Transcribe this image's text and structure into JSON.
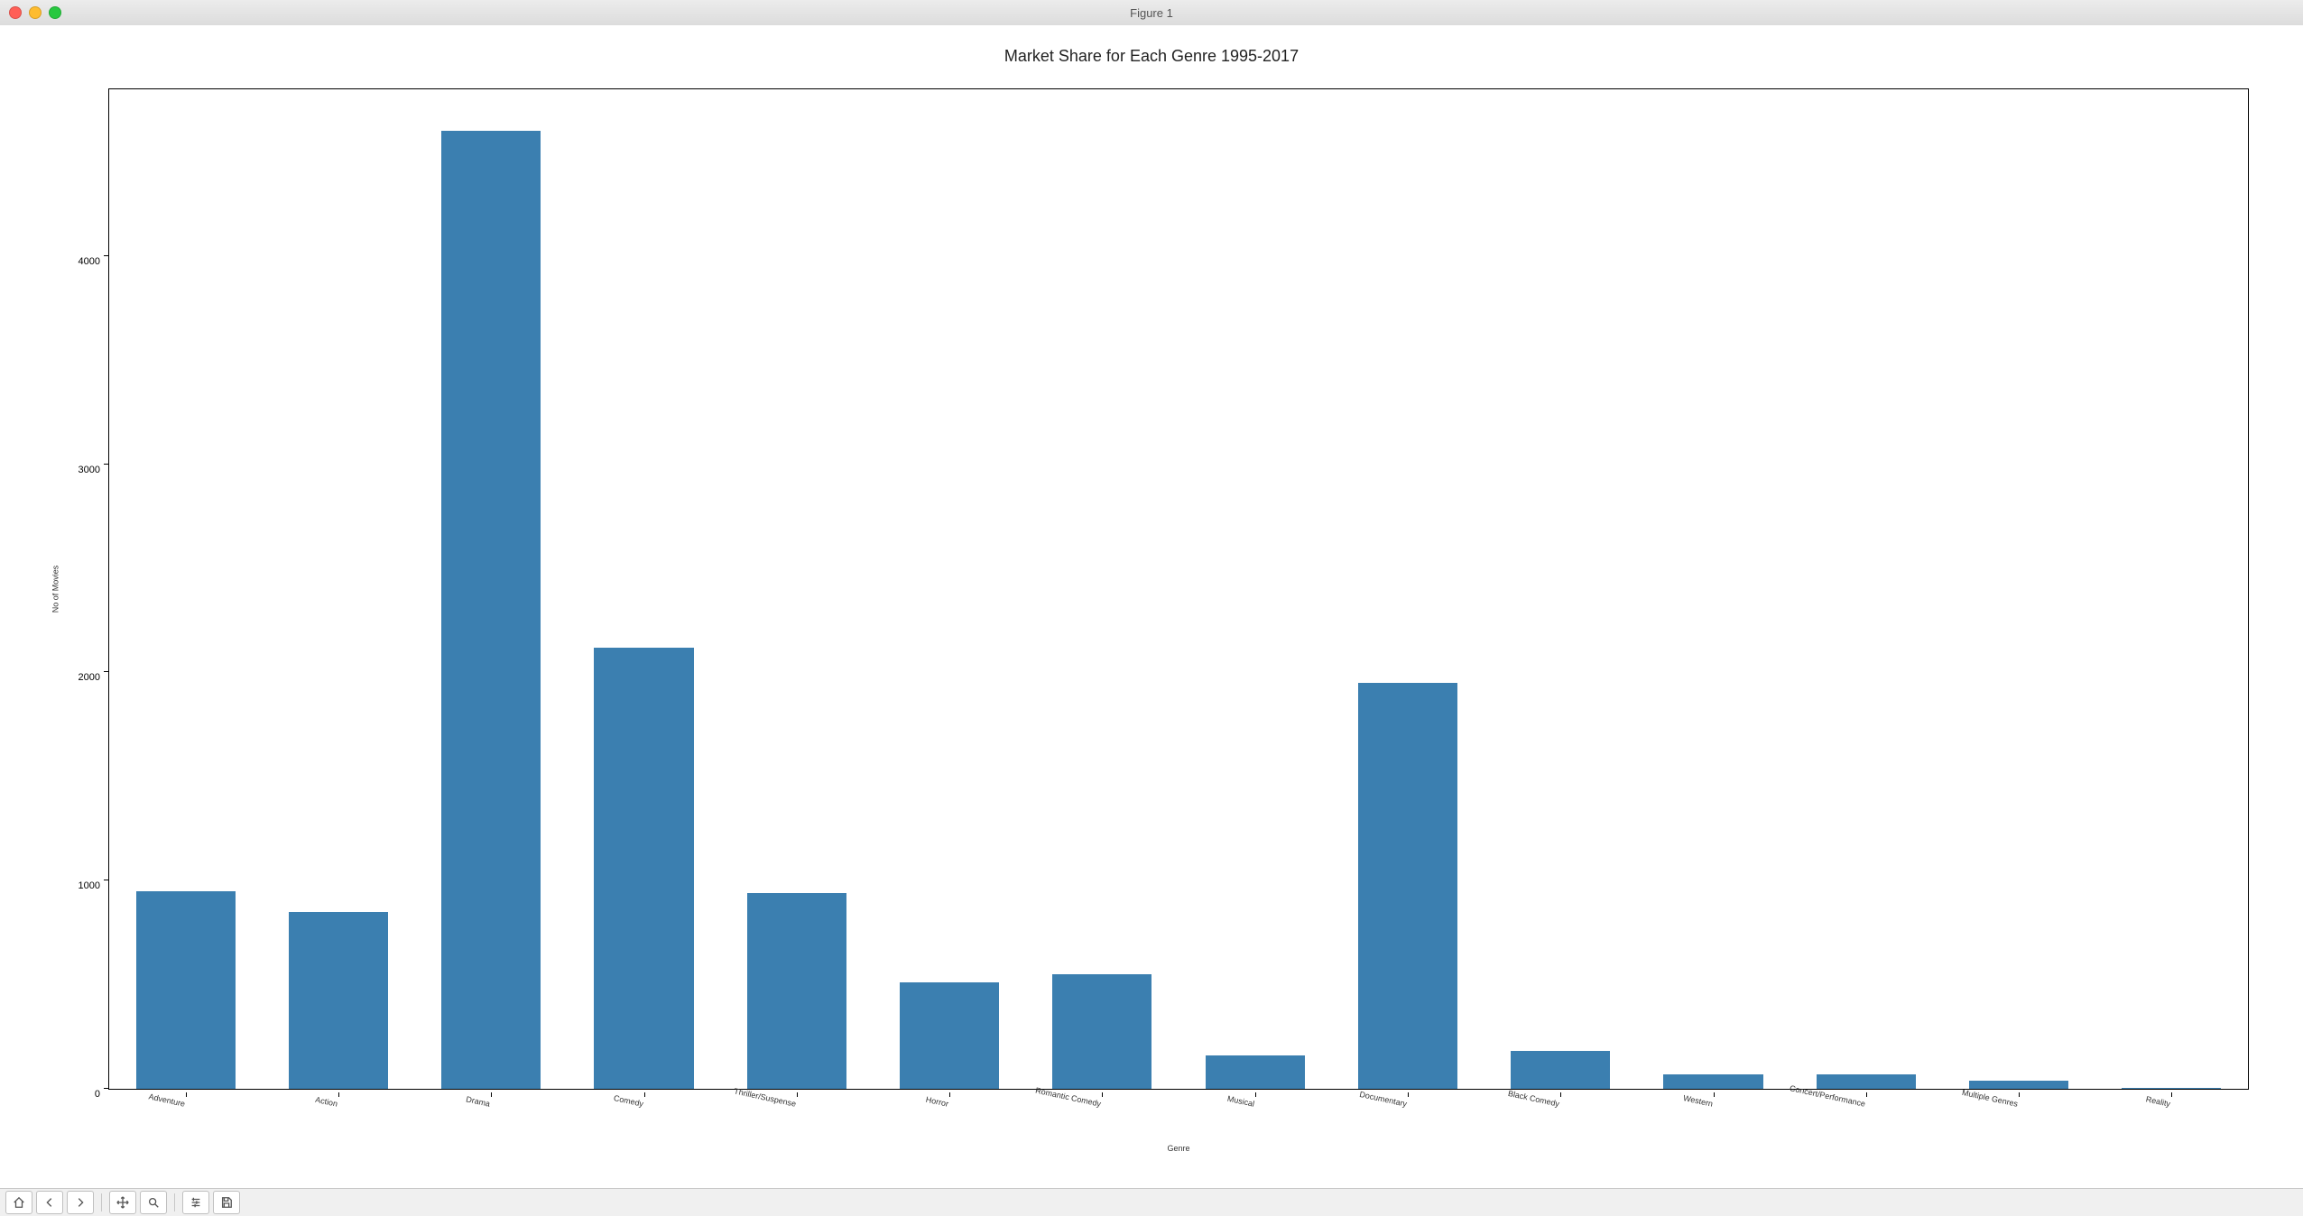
{
  "window": {
    "title": "Figure 1"
  },
  "chart_data": {
    "type": "bar",
    "title": "Market Share for Each Genre 1995-2017",
    "xlabel": "Genre",
    "ylabel": "No of Movies",
    "categories": [
      "Adventure",
      "Action",
      "Drama",
      "Comedy",
      "Thriller/Suspense",
      "Horror",
      "Romantic Comedy",
      "Musical",
      "Documentary",
      "Black Comedy",
      "Western",
      "Concert/Performance",
      "Multiple Genres",
      "Reality"
    ],
    "values": [
      950,
      850,
      4600,
      2120,
      940,
      510,
      550,
      160,
      1950,
      180,
      70,
      70,
      40,
      5
    ],
    "ylim": [
      0,
      4800
    ],
    "yticks": [
      0,
      1000,
      2000,
      3000,
      4000
    ],
    "bar_color": "#3b7fb0"
  },
  "toolbar": {
    "home": "home-icon",
    "back": "back-icon",
    "forward": "forward-icon",
    "pan": "pan-icon",
    "zoom": "zoom-icon",
    "config": "config-icon",
    "save": "save-icon"
  }
}
